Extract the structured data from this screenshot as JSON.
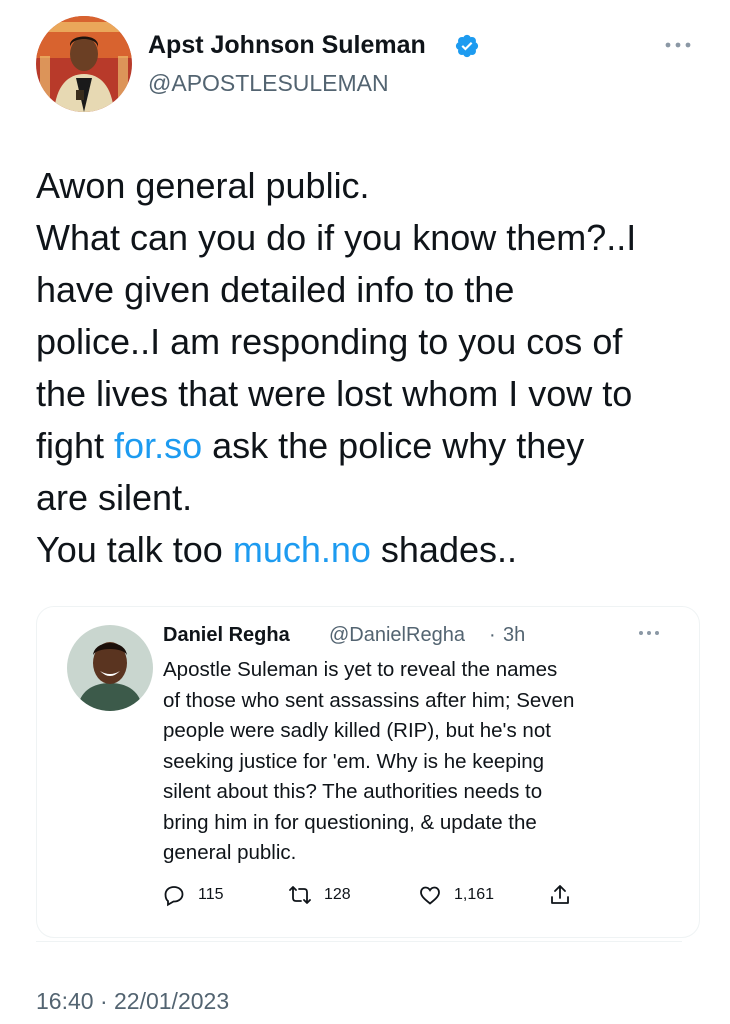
{
  "author": {
    "name": "Apst Johnson Suleman",
    "handle": "@APOSTLESULEMAN",
    "verified_color": "#1d9bf0"
  },
  "tweet": {
    "lines": [
      [
        {
          "t": "Awon general public."
        }
      ],
      [
        {
          "t": "What can you do if you know them?..I"
        }
      ],
      [
        {
          "t": "have given detailed info to the"
        }
      ],
      [
        {
          "t": "police..I am responding to you cos of"
        }
      ],
      [
        {
          "t": "the lives that were lost whom I vow to"
        }
      ],
      [
        {
          "t": "fight "
        },
        {
          "t": "for.so",
          "link": true
        },
        {
          "t": " ask the police why they"
        }
      ],
      [
        {
          "t": "are silent."
        }
      ],
      [
        {
          "t": "You talk too "
        },
        {
          "t": "much.no",
          "link": true
        },
        {
          "t": " shades.."
        }
      ]
    ],
    "timestamp": "16:40 · 22/01/2023"
  },
  "quoted": {
    "name": "Daniel Regha",
    "handle": "@DanielRegha",
    "separator": "·",
    "time": "3h",
    "lines": [
      "Apostle Suleman is yet to reveal the names",
      "of those who sent assassins after him; Seven",
      "people were sadly killed (RIP), but he's not",
      "seeking justice for 'em. Why is he keeping",
      "silent about this? The authorities needs to",
      "bring him in for questioning, & update the",
      "general public."
    ],
    "replies": "115",
    "retweets": "128",
    "likes": "1,161"
  },
  "icons": {
    "more": "more-dots-icon",
    "verified": "verified-badge-icon",
    "reply": "reply-icon",
    "retweet": "retweet-icon",
    "like": "heart-icon",
    "share": "share-icon"
  },
  "colors": {
    "link": "#1d9bf0",
    "secondary_text": "#536471"
  }
}
